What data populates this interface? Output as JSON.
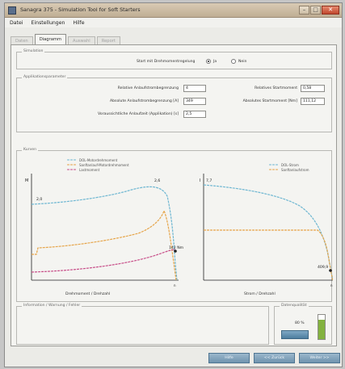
{
  "window": {
    "title": "Sanagra 375 - Simulation Tool for Soft Starters"
  },
  "menu": [
    "Datei",
    "Einstellungen",
    "Hilfe"
  ],
  "tabs": [
    "Daten",
    "Diagramm",
    "Auswahl",
    "Report"
  ],
  "simulation": {
    "legend": "Simulation",
    "question": "Start mit Drehmomentregelung",
    "option_yes": "Ja",
    "option_no": "Nein",
    "selected": "Ja"
  },
  "applikation": {
    "legend": "Applikationsparameter",
    "rows": [
      {
        "label": "Relative Anlaufstrombegrenzung",
        "value": "4"
      },
      {
        "label": "Absolute Anlaufstrombegrenzung [A]",
        "value": "349"
      },
      {
        "label": "Voraussichtliche Anlaufzeit (Applikation) [s]",
        "value": "2,5"
      }
    ],
    "right_rows": [
      {
        "label": "Relatives Startmoment",
        "value": "0,58"
      },
      {
        "label": "Absolutes Startmoment [Nm]",
        "value": "111,12"
      }
    ]
  },
  "kurven": {
    "legend": "Kurven",
    "left": {
      "legend": [
        {
          "name": "DOL-Motordrehmoment",
          "color": "#6fb7d2"
        },
        {
          "name": "Sanftanlauf-Motordrehmoment",
          "color": "#e6a54a"
        },
        {
          "name": "Lastmoment",
          "color": "#c8508a"
        }
      ],
      "y_label": "M",
      "x_label": "Drehmoment / Drehzahl",
      "annotations": [
        "2,0",
        "2,6",
        "142 Nm"
      ]
    },
    "right": {
      "legend": [
        {
          "name": "DOL-Strom",
          "color": "#6fb7d2"
        },
        {
          "name": "Sanftanlaufstrom",
          "color": "#e6a54a"
        }
      ],
      "y_label": "I",
      "x_label": "Strom / Drehzahl",
      "annotations": [
        "7,7",
        "409,9"
      ]
    }
  },
  "info": {
    "legend": "Information / Warnung / Fehler"
  },
  "quality": {
    "legend": "Datenqualität",
    "percent_label": "80 %",
    "level": 0.8
  },
  "buttons": {
    "back": "Hilfe",
    "forward": "<< Zurück",
    "next": "Weiter >>"
  }
}
